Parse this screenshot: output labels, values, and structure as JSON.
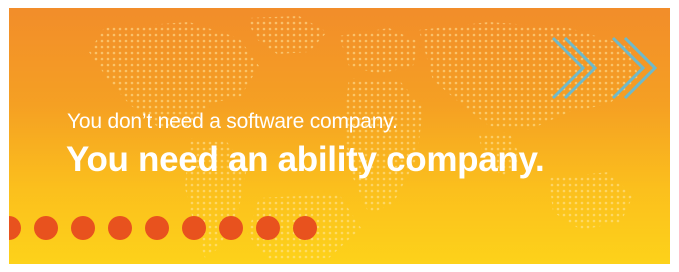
{
  "banner": {
    "headline": "You don’t need a software company.",
    "subheadline": "You need an ability company.",
    "decor": {
      "map_icon": "world-map-dots-icon",
      "chevron_icon": "double-chevron-right-icon",
      "dot_count": 9
    },
    "colors": {
      "gradient_top": "#f28d2a",
      "gradient_bottom": "#fdd21a",
      "text": "#ffffff",
      "dot": "#e8521e",
      "chevron": "#6fb9c9"
    }
  }
}
